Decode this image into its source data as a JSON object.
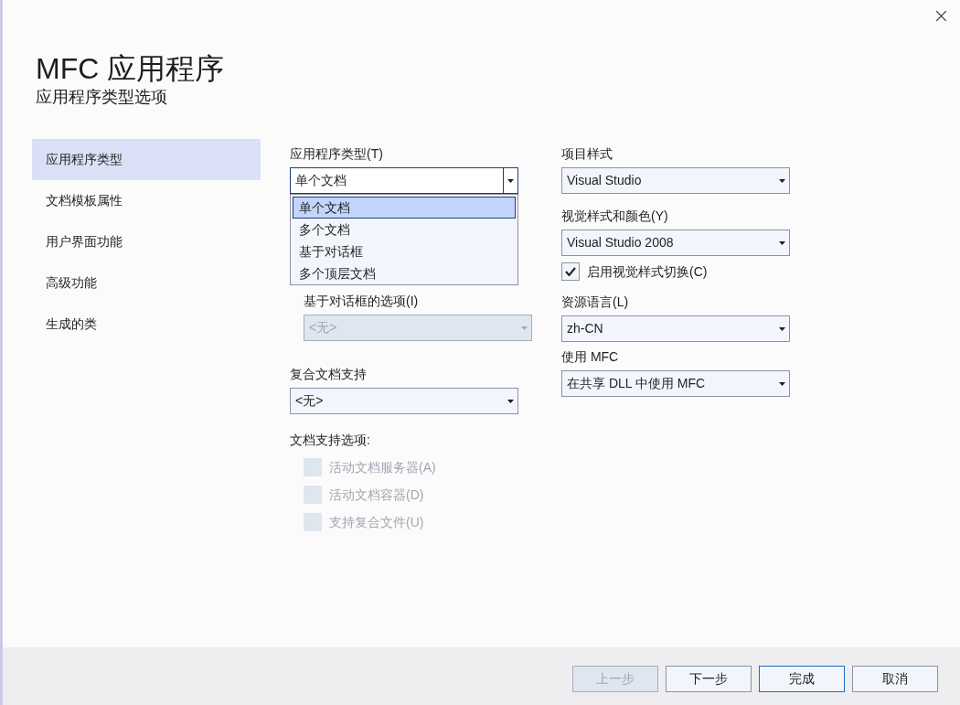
{
  "window": {
    "title": "MFC 应用程序",
    "subtitle": "应用程序类型选项"
  },
  "nav": [
    {
      "label": "应用程序类型",
      "selected": true
    },
    {
      "label": "文档模板属性",
      "selected": false
    },
    {
      "label": "用户界面功能",
      "selected": false
    },
    {
      "label": "高级功能",
      "selected": false
    },
    {
      "label": "生成的类",
      "selected": false
    }
  ],
  "app_type": {
    "label": "应用程序类型(T)",
    "value": "单个文档",
    "expanded": true,
    "options": [
      {
        "label": "单个文档",
        "selected": true
      },
      {
        "label": "多个文档",
        "selected": false
      },
      {
        "label": "基于对话框",
        "selected": false
      },
      {
        "label": "多个顶层文档",
        "selected": false
      }
    ]
  },
  "dialog_options": {
    "label": "基于对话框的选项(I)",
    "value": "<无>",
    "disabled": true
  },
  "compound": {
    "label": "复合文档支持",
    "value": "<无>",
    "disabled": false
  },
  "doc_support": {
    "label": "文档支持选项:",
    "options": [
      {
        "label": "活动文档服务器(A)",
        "checked": false,
        "disabled": true
      },
      {
        "label": "活动文档容器(D)",
        "checked": false,
        "disabled": true
      },
      {
        "label": "支持复合文件(U)",
        "checked": false,
        "disabled": true
      }
    ]
  },
  "project_style": {
    "label": "项目样式",
    "value": "Visual Studio",
    "disabled": false
  },
  "visual_style": {
    "label": "视觉样式和颜色(Y)",
    "value": "Visual Studio 2008",
    "disabled": false
  },
  "visual_toggle": {
    "label": "启用视觉样式切换(C)",
    "checked": true,
    "disabled": false
  },
  "resource_lang": {
    "label": "资源语言(L)",
    "value": "zh-CN",
    "disabled": false
  },
  "use_mfc": {
    "label": "使用 MFC",
    "value": "在共享 DLL 中使用 MFC",
    "disabled": false
  },
  "buttons": [
    {
      "label": "上一步",
      "disabled": true,
      "default": false
    },
    {
      "label": "下一步",
      "disabled": false,
      "default": false
    },
    {
      "label": "完成",
      "disabled": false,
      "default": true
    },
    {
      "label": "取消",
      "disabled": false,
      "default": false
    }
  ]
}
